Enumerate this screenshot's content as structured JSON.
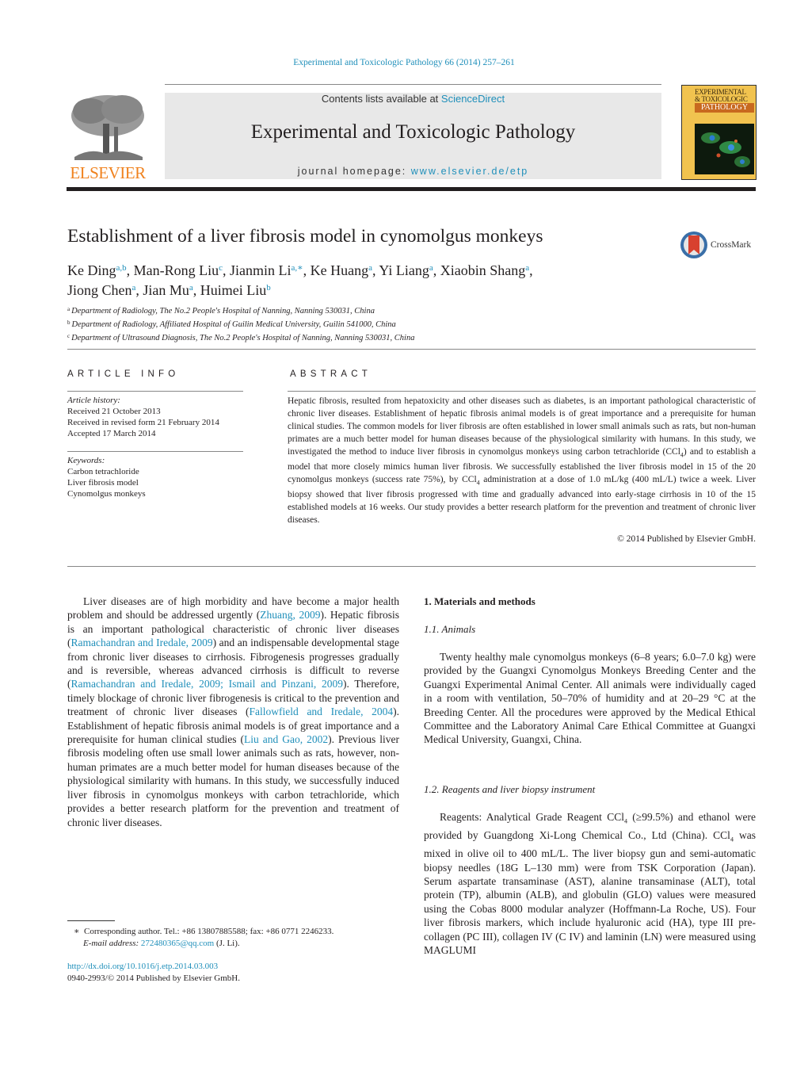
{
  "header": {
    "journal_reference": "Experimental and Toxicologic Pathology 66 (2014) 257–261",
    "contents_prefix": "Contents lists available at ",
    "contents_link": "ScienceDirect",
    "journal_title": "Experimental and Toxicologic Pathology",
    "homepage_prefix": "journal homepage: ",
    "homepage_link": "www.elsevier.de/etp",
    "publisher_logo_text": "ELSEVIER",
    "cover": {
      "title_line1": "EXPERIMENTAL",
      "title_line2": "& TOXICOLOGIC",
      "band": "PATHOLOGY"
    },
    "crossmark_label": "CrossMark",
    "colors": {
      "link": "#1f8fba",
      "elsevier_orange": "#f0821e"
    }
  },
  "article": {
    "title": "Establishment of a liver fibrosis model in cynomolgus monkeys",
    "authors": [
      {
        "name": "Ke Ding",
        "sup": "a,b",
        "sep": ", "
      },
      {
        "name": "Man-Rong Liu",
        "sup": "c",
        "sep": ", "
      },
      {
        "name": "Jianmin Li",
        "sup": "a,∗",
        "sep": ", "
      },
      {
        "name": "Ke Huang",
        "sup": "a",
        "sep": ", "
      },
      {
        "name": "Yi Liang",
        "sup": "a",
        "sep": ", "
      },
      {
        "name": "Xiaobin Shang",
        "sup": "a",
        "sep": ", "
      },
      {
        "name": "Jiong Chen",
        "sup": "a",
        "sep": ", "
      },
      {
        "name": "Jian Mu",
        "sup": "a",
        "sep": ", "
      },
      {
        "name": "Huimei Liu",
        "sup": "b",
        "sep": ""
      }
    ],
    "affiliations": [
      {
        "mark": "a",
        "text": "Department of Radiology, The No.2 People's Hospital of Nanning, Nanning 530031, China"
      },
      {
        "mark": "b",
        "text": "Department of Radiology, Affiliated Hospital of Guilin Medical University, Guilin 541000, China"
      },
      {
        "mark": "c",
        "text": "Department of Ultrasound Diagnosis, The No.2 People's Hospital of Nanning, Nanning 530031, China"
      }
    ]
  },
  "article_info": {
    "heading": "ARTICLE INFO",
    "history_label": "Article history:",
    "history": [
      "Received 21 October 2013",
      "Received in revised form 21 February 2014",
      "Accepted 17 March 2014"
    ],
    "keywords_label": "Keywords:",
    "keywords": [
      "Carbon tetrachloride",
      "Liver fibrosis model",
      "Cynomolgus monkeys"
    ]
  },
  "abstract": {
    "heading": "ABSTRACT",
    "part1": "Hepatic fibrosis, resulted from hepatoxicity and other diseases such as diabetes, is an important pathological characteristic of chronic liver diseases. Establishment of hepatic fibrosis animal models is of great importance and a prerequisite for human clinical studies. The common models for liver fibrosis are often established in lower small animals such as rats, but non-human primates are a much better model for human diseases because of the physiological similarity with humans. In this study, we investigated the method to induce liver fibrosis in cynomolgus monkeys using carbon tetrachloride (CCl",
    "part2": ") and to establish a model that more closely mimics human liver fibrosis. We successfully established the liver fibrosis model in 15 of the 20 cynomolgus monkeys (success rate 75%), by CCl",
    "part3": " administration at a dose of 1.0 mL/kg (400 mL/L) twice a week. Liver biopsy showed that liver fibrosis progressed with time and gradually advanced into early-stage cirrhosis in 10 of the 15 established models at 16 weeks. Our study provides a better research platform for the prevention and treatment of chronic liver diseases.",
    "subscript": "4",
    "copyright": "© 2014 Published by Elsevier GmbH."
  },
  "intro": {
    "s1": "Liver diseases are of high morbidity and have become a major health problem and should be addressed urgently (",
    "c1": "Zhuang, 2009",
    "s2": "). Hepatic fibrosis is an important pathological characteristic of chronic liver diseases (",
    "c2": "Ramachandran and Iredale, 2009",
    "s3": ") and an indispensable developmental stage from chronic liver diseases to cirrhosis. Fibrogenesis progresses gradually and is reversible, whereas advanced cirrhosis is difficult to reverse (",
    "c3": "Ramachandran and Iredale, 2009; Ismail and Pinzani, 2009",
    "s4": "). Therefore, timely blockage of chronic liver fibrogenesis is critical to the prevention and treatment of chronic liver diseases (",
    "c4": "Fallowfield and Iredale, 2004",
    "s5": "). Establishment of hepatic fibrosis animal models is of great importance and a prerequisite for human clinical studies (",
    "c5": "Liu and Gao, 2002",
    "s6": "). Previous liver fibrosis modeling often use small lower animals such as rats, however, non-human primates are a much better model for human diseases because of the physiological similarity with humans. In this study, we successfully induced liver fibrosis in cynomolgus monkeys with carbon tetrachloride, which provides a better research platform for the prevention and treatment of chronic liver diseases."
  },
  "methods": {
    "heading": "1.  Materials and methods",
    "sub1_heading": "1.1.  Animals",
    "sub1_text": "Twenty healthy male cynomolgus monkeys (6–8 years; 6.0–7.0 kg) were provided by the Guangxi Cynomolgus Monkeys Breeding Center and the Guangxi Experimental Animal Center. All animals were individually caged in a room with ventilation, 50–70% of humidity and at 20–29 °C at the Breeding Center. All the procedures were approved by the Medical Ethical Committee and the Laboratory Animal Care Ethical Committee at Guangxi Medical University, Guangxi, China.",
    "sub2_heading": "1.2.  Reagents and liver biopsy instrument",
    "sub2_a": "Reagents: Analytical Grade Reagent CCl",
    "sub2_b": " (≥99.5%) and ethanol were provided by Guangdong Xi-Long Chemical Co., Ltd (China). CCl",
    "sub2_c": " was mixed in olive oil to 400 mL/L. The liver biopsy gun and semi-automatic biopsy needles (18G L–130 mm) were from TSK Corporation (Japan). Serum aspartate transaminase (AST), alanine transaminase (ALT), total protein (TP), albumin (ALB), and globulin (GLO) values were measured using the Cobas 8000 modular analyzer (Hoffmann-La Roche, US). Four liver fibrosis markers, which include hyaluronic acid (HA), type III pre-collagen (PC III), collagen IV (C IV) and laminin (LN) were measured using MAGLUMI",
    "subscript": "4"
  },
  "footer": {
    "footnote_mark": "∗",
    "footnote_text": "Corresponding author. Tel.: +86 13807885588; fax: +86 0771 2246233.",
    "email_label": "E-mail address: ",
    "email": "272480365@qq.com",
    "email_suffix": " (J. Li).",
    "doi": "http://dx.doi.org/10.1016/j.etp.2014.03.003",
    "issn_line": "0940-2993/© 2014 Published by Elsevier GmbH."
  }
}
